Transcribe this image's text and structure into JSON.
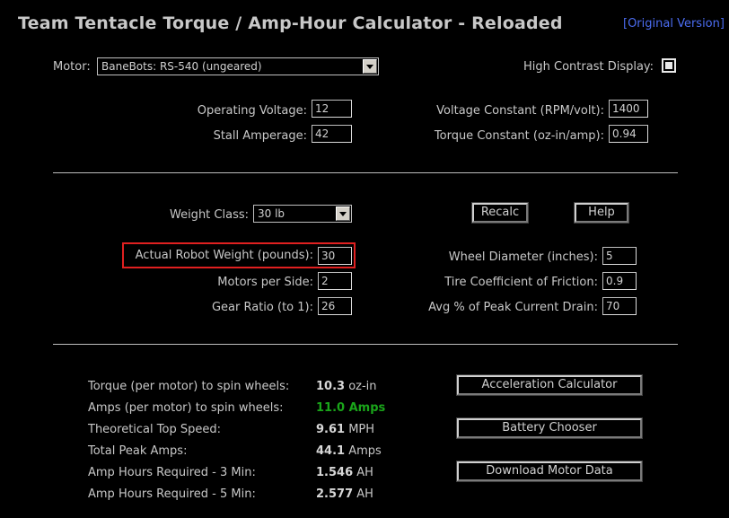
{
  "header": {
    "title": "Team Tentacle Torque / Amp-Hour Calculator - Reloaded",
    "original_link": "[Original Version]"
  },
  "motor": {
    "label": "Motor:",
    "selected": "BaneBots: RS-540 (ungeared)"
  },
  "high_contrast": {
    "label": "High Contrast Display:",
    "checked": true
  },
  "motor_specs": {
    "operating_voltage_label": "Operating Voltage:",
    "operating_voltage": "12",
    "stall_amperage_label": "Stall Amperage:",
    "stall_amperage": "42",
    "voltage_constant_label": "Voltage Constant (RPM/volt):",
    "voltage_constant": "1400",
    "torque_constant_label": "Torque Constant (oz-in/amp):",
    "torque_constant": "0.94"
  },
  "robot": {
    "weight_class_label": "Weight Class:",
    "weight_class": "30 lb",
    "recalc_label": "Recalc",
    "help_label": "Help",
    "actual_weight_label": "Actual Robot Weight (pounds):",
    "actual_weight": "30",
    "motors_per_side_label": "Motors per Side:",
    "motors_per_side": "2",
    "gear_ratio_label": "Gear Ratio (to 1):",
    "gear_ratio": "26",
    "wheel_diameter_label": "Wheel Diameter (inches):",
    "wheel_diameter": "5",
    "tire_friction_label": "Tire Coefficient of Friction:",
    "tire_friction": "0.9",
    "avg_drain_label": "Avg % of Peak Current Drain:",
    "avg_drain": "70"
  },
  "results": [
    {
      "label": "Torque (per motor) to spin wheels:",
      "value": "10.3",
      "unit": "oz-in"
    },
    {
      "label": "Amps (per motor) to spin wheels:",
      "value": "11.0 Amps",
      "unit": ""
    },
    {
      "label": "Theoretical Top Speed:",
      "value": "9.61",
      "unit": "MPH"
    },
    {
      "label": "Total Peak Amps:",
      "value": "44.1",
      "unit": "Amps"
    },
    {
      "label": "Amp Hours Required - 3 Min:",
      "value": "1.546",
      "unit": "AH"
    },
    {
      "label": "Amp Hours Required - 5 Min:",
      "value": "2.577",
      "unit": "AH"
    }
  ],
  "actions": {
    "acceleration_label": "Acceleration Calculator",
    "battery_label": "Battery Chooser",
    "download_label": "Download Motor Data"
  },
  "colors": {
    "background": "#000000",
    "amps_highlight": "#1aa51a",
    "weight_highlight_border": "#e02020"
  }
}
